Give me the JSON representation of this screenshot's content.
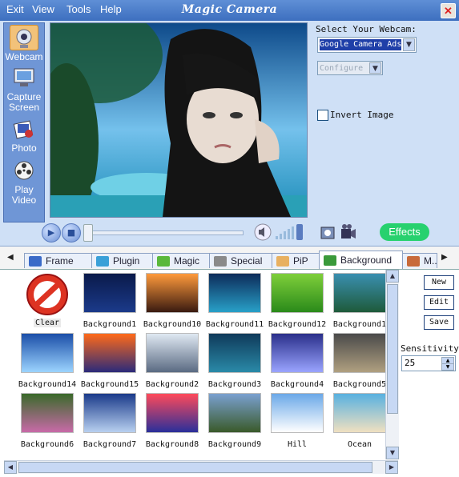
{
  "app": {
    "title": "Magic Camera"
  },
  "menubar": {
    "items": [
      "Exit",
      "View",
      "Tools",
      "Help"
    ]
  },
  "sidebar": {
    "items": [
      {
        "label": "Webcam",
        "icon": "webcam-icon"
      },
      {
        "label": "Capture Screen",
        "icon": "monitor-icon"
      },
      {
        "label": "Photo",
        "icon": "photo-icon"
      },
      {
        "label": "Play Video",
        "icon": "film-reel-icon"
      }
    ]
  },
  "webcam_panel": {
    "select_label": "Select Your Webcam:",
    "webcam_value": "Google Camera Ads",
    "configure_label": "Configure",
    "invert_label": "Invert Image"
  },
  "controls": {
    "effects_label": "Effects"
  },
  "tabs": [
    "Frame",
    "Plugin",
    "Magic",
    "Special",
    "PiP",
    "Background",
    "M..."
  ],
  "gallery": {
    "items": [
      {
        "label": "Clear",
        "colors": [
          "#e8e8e8",
          "#d32"
        ]
      },
      {
        "label": "Background1",
        "colors": [
          "#0a1a4a",
          "#1b3a8a"
        ]
      },
      {
        "label": "Background10",
        "colors": [
          "#ff9a3c",
          "#3a1a10"
        ]
      },
      {
        "label": "Background11",
        "colors": [
          "#0d2c5a",
          "#28a0c8"
        ]
      },
      {
        "label": "Background12",
        "colors": [
          "#7fcf3a",
          "#2a8a1a"
        ]
      },
      {
        "label": "Background1",
        "colors": [
          "#3a8fb0",
          "#1e5a3a"
        ]
      },
      {
        "label": "Background14",
        "colors": [
          "#1b4ea8",
          "#9cd4ff"
        ]
      },
      {
        "label": "Background15",
        "colors": [
          "#ff6a1a",
          "#2b2a7a"
        ]
      },
      {
        "label": "Background2",
        "colors": [
          "#dfe8f2",
          "#5a6a82"
        ]
      },
      {
        "label": "Background3",
        "colors": [
          "#0f3a5a",
          "#2a8aa8"
        ]
      },
      {
        "label": "Background4",
        "colors": [
          "#2a2f8a",
          "#9aa4ff"
        ]
      },
      {
        "label": "Background5",
        "colors": [
          "#4a4a4a",
          "#b0a080"
        ]
      },
      {
        "label": "Background6",
        "colors": [
          "#3a6a2a",
          "#c86aa8"
        ]
      },
      {
        "label": "Background7",
        "colors": [
          "#1a3a8a",
          "#b8d0f0"
        ]
      },
      {
        "label": "Background8",
        "colors": [
          "#ff4a5a",
          "#2a2f9a"
        ]
      },
      {
        "label": "Background9",
        "colors": [
          "#7aa0d0",
          "#3a5a2a"
        ]
      },
      {
        "label": "Hill",
        "colors": [
          "#6aa8e8",
          "#ffffff"
        ]
      },
      {
        "label": "Ocean",
        "colors": [
          "#58b0e0",
          "#f0e0c0"
        ]
      }
    ]
  },
  "right_panel": {
    "new_label": "New",
    "edit_label": "Edit",
    "save_label": "Save",
    "sensitivity_label": "Sensitivity:",
    "sensitivity_value": "25"
  }
}
